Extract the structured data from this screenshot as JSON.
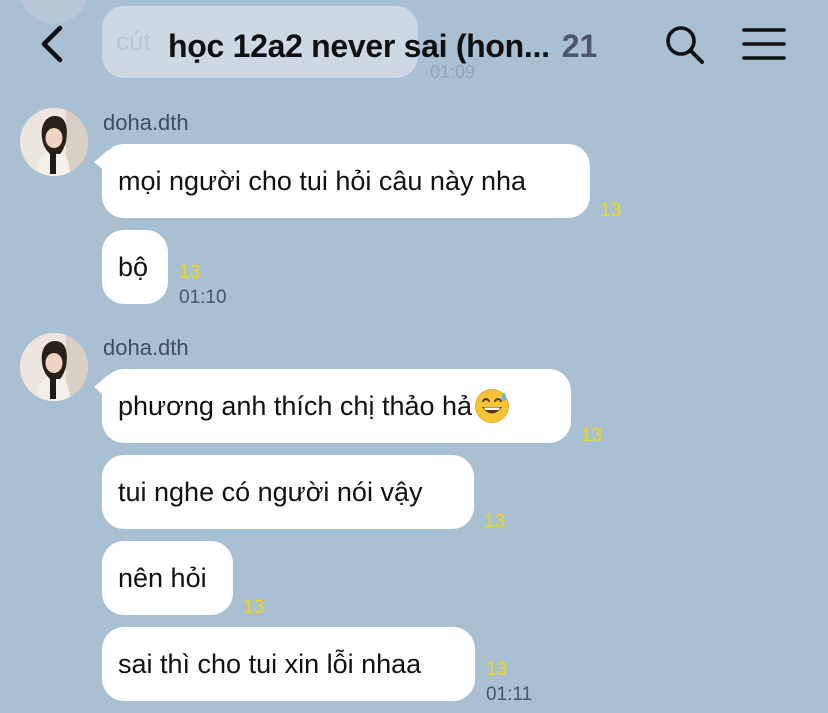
{
  "header": {
    "title": "học 12a2 never sai (hon...",
    "member_count": "21"
  },
  "previous_message": {
    "text": "cút",
    "time": "01:09"
  },
  "groups": [
    {
      "sender": "doha.dth",
      "messages": [
        {
          "text": "mọi người cho tui hỏi câu này nha",
          "read_count": "13"
        },
        {
          "text": "bộ",
          "read_count": "13",
          "time": "01:10"
        }
      ]
    },
    {
      "sender": "doha.dth",
      "messages": [
        {
          "text": "phương anh thích chị thảo hả",
          "emoji": "grinning-sweat-emoji",
          "read_count": "13"
        },
        {
          "text": "tui nghe có người nói vậy",
          "read_count": "13"
        },
        {
          "text": "nên hỏi",
          "read_count": "13"
        },
        {
          "text": "sai thì cho tui xin lỗi nhaa",
          "read_count": "13",
          "time": "01:11"
        }
      ]
    }
  ],
  "icons": {
    "back": "chevron-left-icon",
    "search": "search-icon",
    "menu": "hamburger-menu-icon"
  },
  "colors": {
    "background": "#a9bfd2",
    "bubble": "#ffffff",
    "read_count": "#f3da0b",
    "timestamp": "#485867"
  }
}
